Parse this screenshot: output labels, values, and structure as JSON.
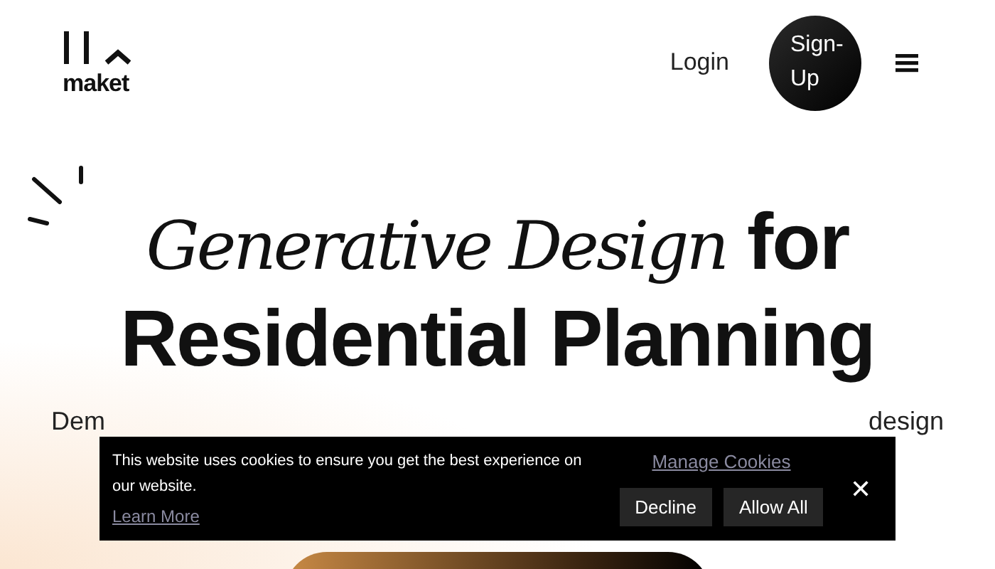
{
  "header": {
    "logo_text": "maket",
    "login": "Login",
    "signup": "Sign-Up"
  },
  "hero": {
    "title_italic": "Generative Design",
    "title_rest": "for",
    "title_line2": "Residential Planning",
    "subtitle_start": "Dem",
    "subtitle_end": "design"
  },
  "cookie_banner": {
    "message": "This website uses cookies to ensure you get the best experience on our website.",
    "learn_more": "Learn More",
    "manage": "Manage Cookies",
    "buttons": [
      "Decline",
      "Allow All"
    ],
    "close": "✕"
  }
}
